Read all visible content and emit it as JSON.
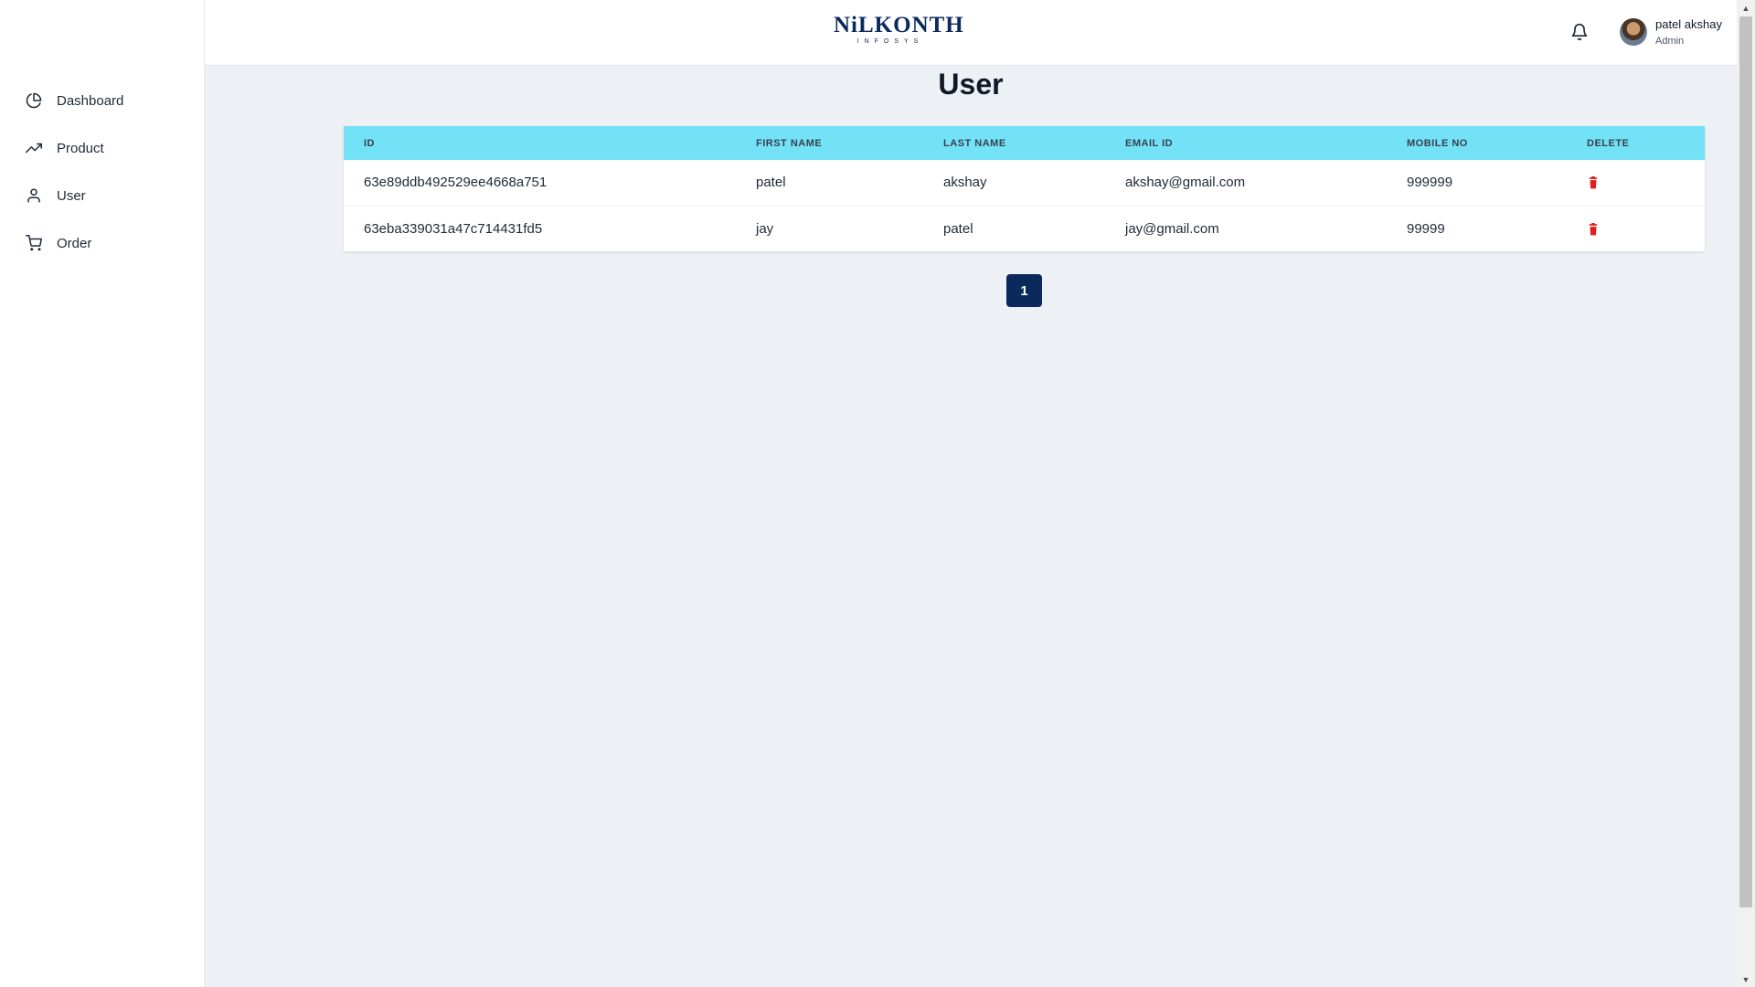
{
  "brand": {
    "name": "NiLKONTH",
    "tagline": "INFOSYS"
  },
  "sidebar": {
    "items": [
      {
        "label": "Dashboard",
        "icon": "pie-chart-icon"
      },
      {
        "label": "Product",
        "icon": "trending-up-icon"
      },
      {
        "label": "User",
        "icon": "user-icon"
      },
      {
        "label": "Order",
        "icon": "cart-icon"
      }
    ]
  },
  "header": {
    "notification_icon": "bell-icon",
    "user": {
      "name": "patel akshay",
      "role": "Admin"
    }
  },
  "main": {
    "title": "User",
    "table": {
      "columns": [
        "ID",
        "FIRST NAME",
        "LAST NAME",
        "EMAIL ID",
        "MOBILE NO",
        "DELETE"
      ],
      "rows": [
        {
          "id": "63e89ddb492529ee4668a751",
          "first_name": "patel",
          "last_name": "akshay",
          "email": "akshay@gmail.com",
          "mobile": "999999"
        },
        {
          "id": "63eba339031a47c714431fd5",
          "first_name": "jay",
          "last_name": "patel",
          "email": "jay@gmail.com",
          "mobile": "99999"
        }
      ],
      "header_color": "#74e2f6",
      "delete_icon": "trash-icon",
      "delete_color": "#e11d1d"
    },
    "pagination": {
      "pages": [
        "1"
      ],
      "current": "1",
      "color": "#0b2a5b"
    }
  }
}
